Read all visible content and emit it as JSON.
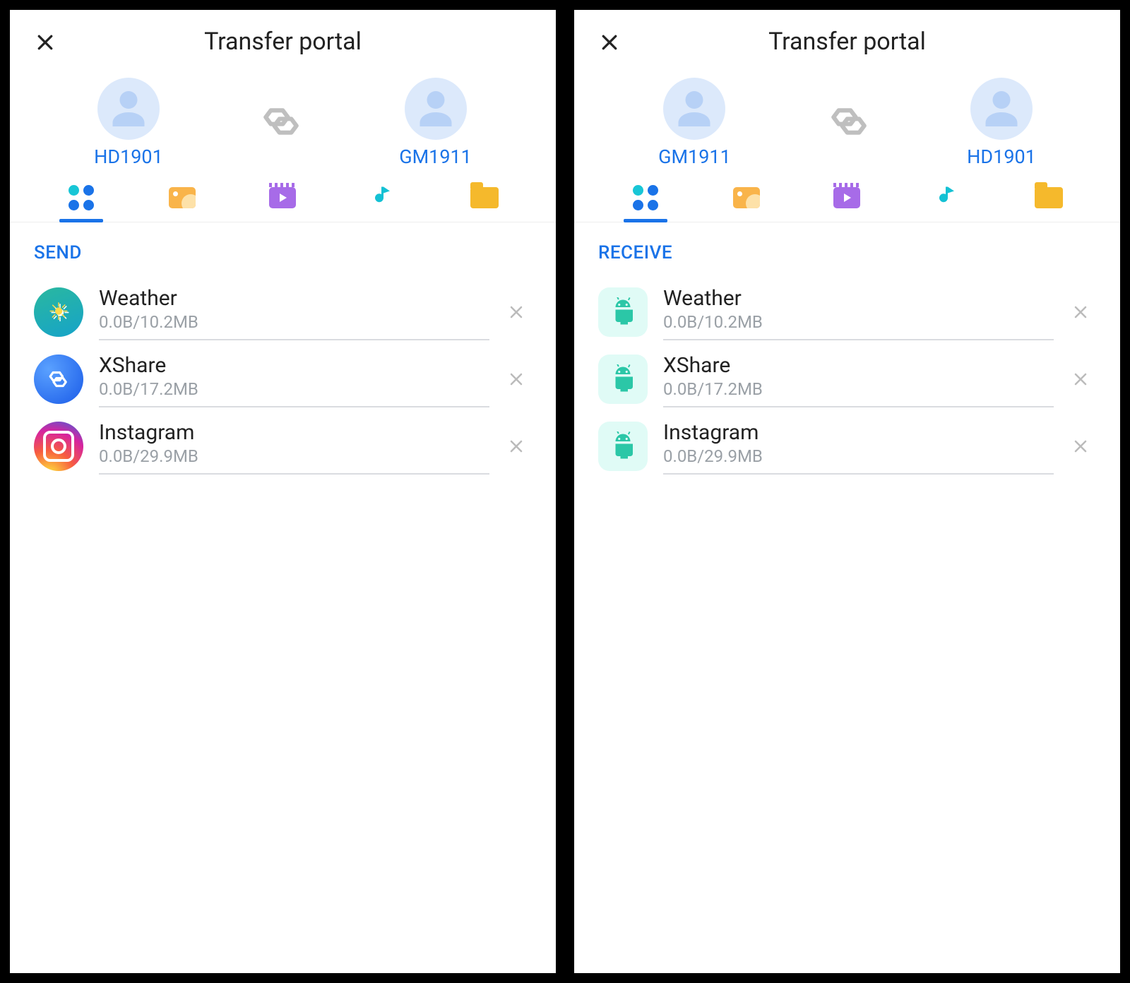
{
  "panels": [
    {
      "title": "Transfer portal",
      "peerLeft": "HD1901",
      "peerRight": "GM1911",
      "sectionLabel": "SEND",
      "iconStyle": "color",
      "items": [
        {
          "name": "Weather",
          "meta": "0.0B/10.2MB",
          "icon": "weather"
        },
        {
          "name": "XShare",
          "meta": "0.0B/17.2MB",
          "icon": "xshare"
        },
        {
          "name": "Instagram",
          "meta": "0.0B/29.9MB",
          "icon": "instagram"
        }
      ]
    },
    {
      "title": "Transfer portal",
      "peerLeft": "GM1911",
      "peerRight": "HD1901",
      "sectionLabel": "RECEIVE",
      "iconStyle": "android",
      "items": [
        {
          "name": "Weather",
          "meta": "0.0B/10.2MB",
          "icon": "android"
        },
        {
          "name": "XShare",
          "meta": "0.0B/17.2MB",
          "icon": "android"
        },
        {
          "name": "Instagram",
          "meta": "0.0B/29.9MB",
          "icon": "android"
        }
      ]
    }
  ],
  "tabs": [
    "apps",
    "photos",
    "videos",
    "music",
    "files"
  ],
  "activeTab": "apps"
}
